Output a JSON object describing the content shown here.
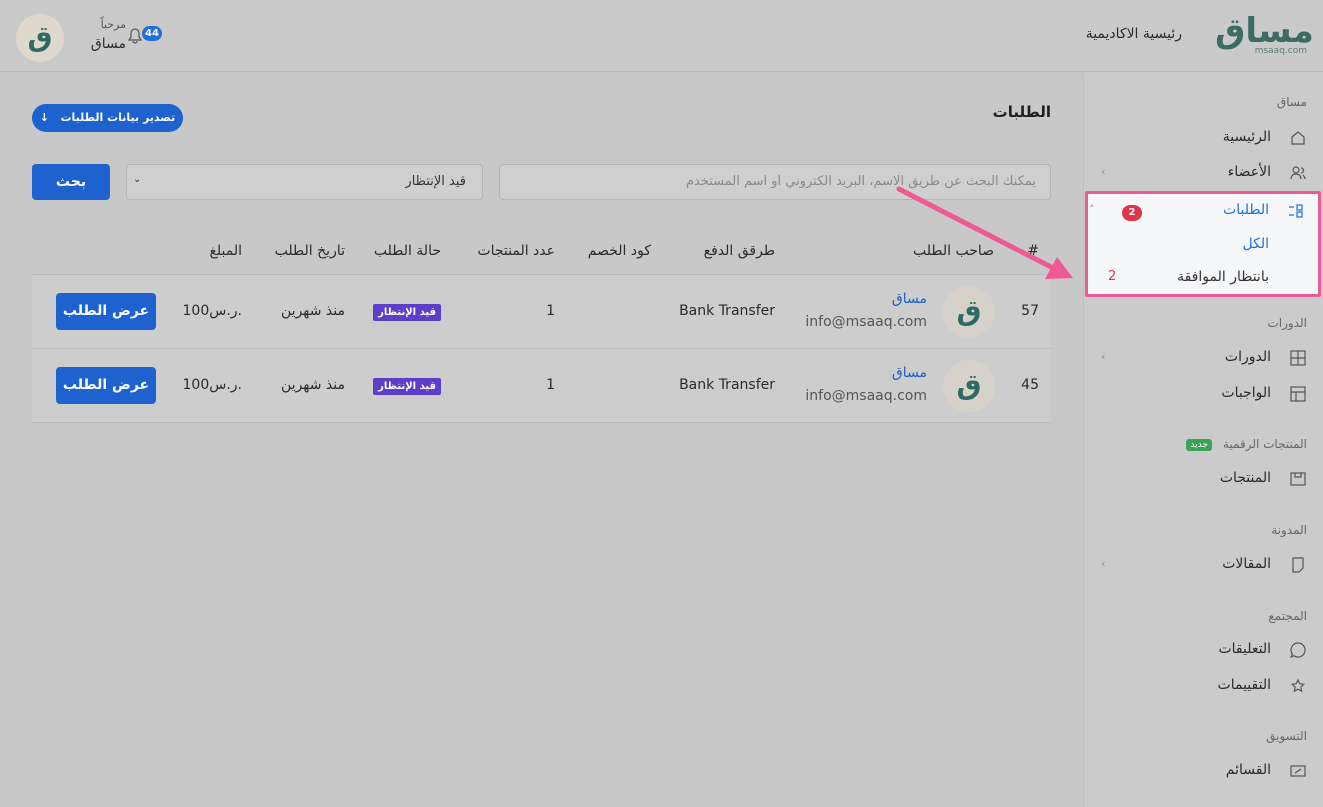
{
  "header": {
    "logo_text": "مساق",
    "logo_sub": "msaaq.com",
    "home_link": "رئيسية الاكاديمية",
    "greeting": "مرحباً",
    "user_name": "مساق",
    "avatar_letter": "ق",
    "notification_count": "44"
  },
  "sidebar": {
    "sections": [
      {
        "title": "مساق",
        "items": [
          {
            "label": "الرئيسية",
            "icon": "home-icon"
          },
          {
            "label": "الأعضاء",
            "icon": "users-icon"
          },
          {
            "label": "الطلبات",
            "icon": "list-icon",
            "count": "2",
            "sub": [
              {
                "label": "الكل"
              },
              {
                "label": "بانتظار الموافقة",
                "count": "2"
              }
            ]
          }
        ]
      },
      {
        "title": "الدورات",
        "items": [
          {
            "label": "الدورات",
            "icon": "grid-icon"
          },
          {
            "label": "الواجبات",
            "icon": "layout-icon"
          }
        ]
      },
      {
        "title": "المنتجات الرقمية",
        "badge": "جديد",
        "items": [
          {
            "label": "المنتجات",
            "icon": "box-icon"
          }
        ]
      },
      {
        "title": "المدونة",
        "items": [
          {
            "label": "المقالات",
            "icon": "bookmark-icon"
          }
        ]
      },
      {
        "title": "المجتمع",
        "items": [
          {
            "label": "التعليقات",
            "icon": "chat-icon"
          },
          {
            "label": "التقييمات",
            "icon": "rating-icon"
          }
        ]
      },
      {
        "title": "التسويق",
        "items": [
          {
            "label": "القسائم",
            "icon": "coupon-icon"
          }
        ]
      }
    ]
  },
  "main": {
    "title": "الطلبات",
    "export_label": "تصدير بيانات الطلبات",
    "export_icon": "↓",
    "search_placeholder": "يمكنك البحث عن طريق الاسم، البريد الكتروني او اسم المستخدم",
    "status_selected": "قيد الإنتظار",
    "search_button": "بحث",
    "columns": [
      "#",
      "صاحب الطلب",
      "طرقق الدفع",
      "كود الخصم",
      "عدد المنتجات",
      "حالة الطلب",
      "تاريخ الطلب",
      "المبلغ"
    ],
    "rows": [
      {
        "id": "57",
        "name": "مساق",
        "email": "info@msaaq.com",
        "avatar": "ق",
        "payment": "Bank Transfer",
        "coupon": "",
        "products": "1",
        "status": "قيد الإنتظار",
        "date": "منذ شهرين",
        "amount": "100ر.س.",
        "action": "عرض الطلب"
      },
      {
        "id": "45",
        "name": "مساق",
        "email": "info@msaaq.com",
        "avatar": "ق",
        "payment": "Bank Transfer",
        "coupon": "",
        "products": "1",
        "status": "قيد الإنتظار",
        "date": "منذ شهرين",
        "amount": "100ر.س.",
        "action": "عرض الطلب"
      }
    ]
  },
  "colors": {
    "accent": "#1e62cf",
    "highlight": "#ee5a93",
    "badge": "#e0344b",
    "status": "#5d3fc7"
  }
}
